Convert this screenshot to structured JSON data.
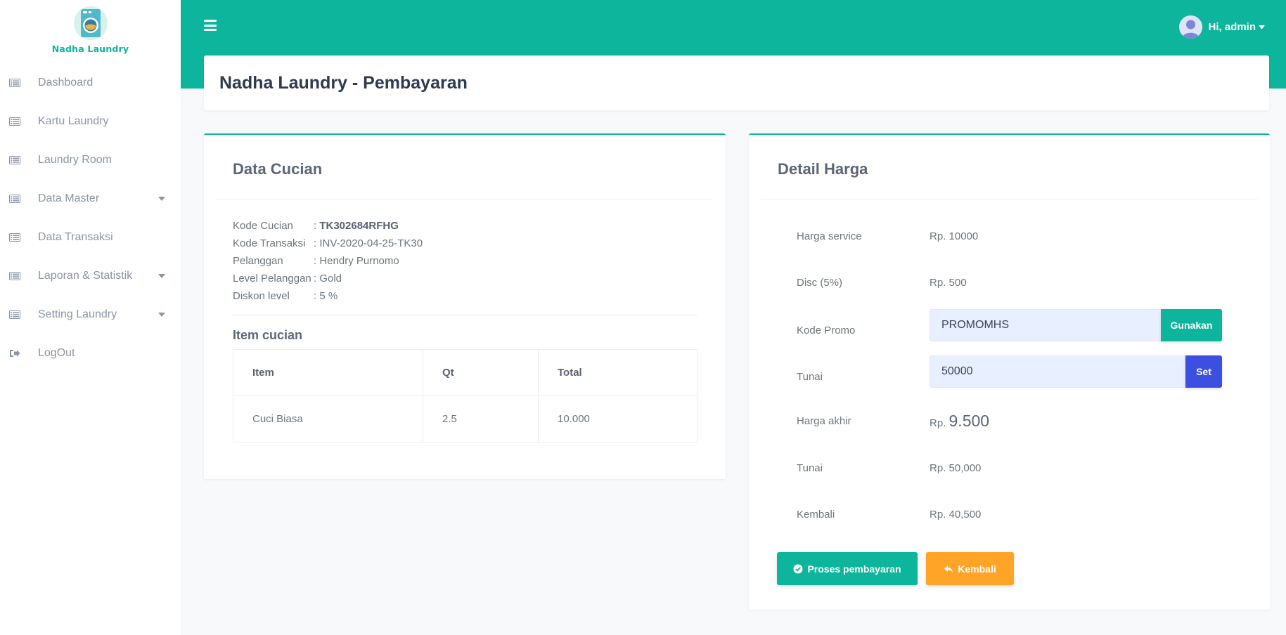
{
  "brand": {
    "name": "Nadha Laundry"
  },
  "sidebar": {
    "items": [
      {
        "label": "Dashboard",
        "icon": "list-icon",
        "has_dropdown": false
      },
      {
        "label": "Kartu Laundry",
        "icon": "list-icon",
        "has_dropdown": false
      },
      {
        "label": "Laundry Room",
        "icon": "list-icon",
        "has_dropdown": false
      },
      {
        "label": "Data Master",
        "icon": "list-icon",
        "has_dropdown": true
      },
      {
        "label": "Data Transaksi",
        "icon": "list-icon",
        "has_dropdown": false
      },
      {
        "label": "Laporan & Statistik",
        "icon": "list-icon",
        "has_dropdown": true
      },
      {
        "label": "Setting Laundry",
        "icon": "list-icon",
        "has_dropdown": true
      },
      {
        "label": "LogOut",
        "icon": "sign-out-icon",
        "has_dropdown": false
      }
    ]
  },
  "topbar": {
    "user_greeting": "Hi, admin"
  },
  "page": {
    "title": "Nadha Laundry - Pembayaran"
  },
  "data_cucian": {
    "title": "Data Cucian",
    "info": [
      {
        "label": "Kode Cucian",
        "value": "TK302684RFHG",
        "bold": true
      },
      {
        "label": "Kode Transaksi",
        "value": "INV-2020-04-25-TK30",
        "bold": false
      },
      {
        "label": "Pelanggan",
        "value": "Hendry Purnomo",
        "bold": false
      },
      {
        "label": "Level Pelanggan",
        "value": "Gold",
        "bold": false
      },
      {
        "label": "Diskon level",
        "value": "5 %",
        "bold": false
      }
    ],
    "separator": ": ",
    "items_title": "Item cucian",
    "table": {
      "headers": [
        "Item",
        "Qt",
        "Total"
      ],
      "rows": [
        [
          "Cuci Biasa",
          "2.5",
          "10.000"
        ]
      ]
    }
  },
  "detail_harga": {
    "title": "Detail Harga",
    "harga_service": {
      "label": "Harga service",
      "value": "Rp. 10000"
    },
    "disc": {
      "label": "Disc (5%)",
      "value": "Rp. 500"
    },
    "kode_promo": {
      "label": "Kode Promo",
      "value": "PROMOMHS",
      "button": "Gunakan"
    },
    "tunai_input": {
      "label": "Tunai",
      "value": "50000",
      "button": "Set"
    },
    "harga_akhir": {
      "label": "Harga akhir",
      "prefix": "Rp.",
      "value": "9.500"
    },
    "tunai": {
      "label": "Tunai",
      "value": "Rp. 50,000"
    },
    "kembali": {
      "label": "Kembali",
      "value": "Rp. 40,500"
    },
    "actions": {
      "proses_label": "Proses pembayaran",
      "kembali_label": "Kembali"
    }
  },
  "colors": {
    "primary": "#0cb59b",
    "blue": "#3c4fe0",
    "warning": "#ffa426"
  }
}
